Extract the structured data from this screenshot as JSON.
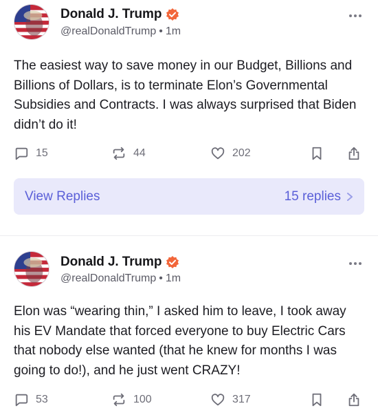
{
  "posts": [
    {
      "author": {
        "name": "Donald J. Trump",
        "handle": "@realDonaldTrump",
        "separator": "•",
        "time": "1m",
        "verified": true
      },
      "body": "The easiest way to save money in our Budget, Billions and Billions of Dollars, is to terminate Elon’s Governmental Subsidies and Contracts. I was always surprised that Biden didn’t do it!",
      "counts": {
        "replies": "15",
        "retruths": "44",
        "likes": "202"
      },
      "replies_box": {
        "label": "View Replies",
        "count_label": "15 replies"
      }
    },
    {
      "author": {
        "name": "Donald J. Trump",
        "handle": "@realDonaldTrump",
        "separator": "•",
        "time": "1m",
        "verified": true
      },
      "body": "Elon was “wearing thin,” I asked him to leave, I took away his EV Mandate that forced everyone to buy Electric Cars that nobody else wanted (that he knew for months I was going to do!), and he just went CRAZY!",
      "counts": {
        "replies": "53",
        "retruths": "100",
        "likes": "317"
      }
    }
  ],
  "colors": {
    "accent": "#5a5fd8",
    "replies_bg": "#e9e9fb",
    "verified": "#f2663a",
    "muted": "#6e6e78"
  }
}
